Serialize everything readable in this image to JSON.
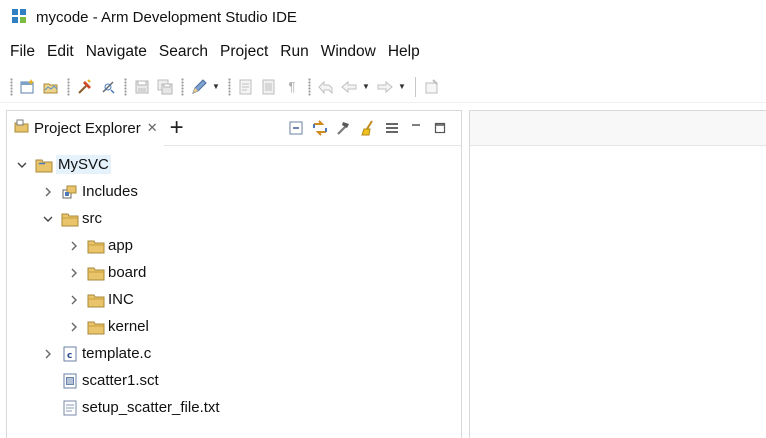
{
  "window": {
    "title": "mycode - Arm Development Studio IDE",
    "app_icon": "arm-ds-icon"
  },
  "menu": [
    "File",
    "Edit",
    "Navigate",
    "Search",
    "Project",
    "Run",
    "Window",
    "Help"
  ],
  "toolbar": {
    "icons": [
      "new-wizard-icon",
      "open-folder-icon",
      "build-icon",
      "debug-icon",
      "save-icon",
      "save-all-icon",
      "pencil-icon",
      "task-icon",
      "list-icon",
      "pilcrow-icon",
      "back-nav-icon",
      "back-icon",
      "forward-icon",
      "pin-editor-icon"
    ]
  },
  "project_explorer": {
    "tab_label": "Project Explorer",
    "tab_close": "✕",
    "new_view_label": "+",
    "actions": [
      "collapse-all-icon",
      "link-with-editor-icon",
      "hammer-icon",
      "broom-icon",
      "view-menu-icon",
      "minimize-icon",
      "maximize-icon"
    ],
    "tree": [
      {
        "label": "MySVC",
        "level": 0,
        "expanded": true,
        "type": "project",
        "selected": true
      },
      {
        "label": "Includes",
        "level": 1,
        "expanded": false,
        "type": "includes"
      },
      {
        "label": "src",
        "level": 1,
        "expanded": true,
        "type": "folder"
      },
      {
        "label": "app",
        "level": 2,
        "expanded": false,
        "type": "folder"
      },
      {
        "label": "board",
        "level": 2,
        "expanded": false,
        "type": "folder"
      },
      {
        "label": "INC",
        "level": 2,
        "expanded": false,
        "type": "folder"
      },
      {
        "label": "kernel",
        "level": 2,
        "expanded": false,
        "type": "folder"
      },
      {
        "label": "template.c",
        "level": 1,
        "expanded": false,
        "type": "c-file"
      },
      {
        "label": "scatter1.sct",
        "level": 1,
        "expanded": null,
        "type": "sct-file"
      },
      {
        "label": "setup_scatter_file.txt",
        "level": 1,
        "expanded": null,
        "type": "txt-file"
      }
    ]
  },
  "colors": {
    "folder": "#e8b24a",
    "selection": "#e5f1fb",
    "border": "#d9d9d9"
  }
}
